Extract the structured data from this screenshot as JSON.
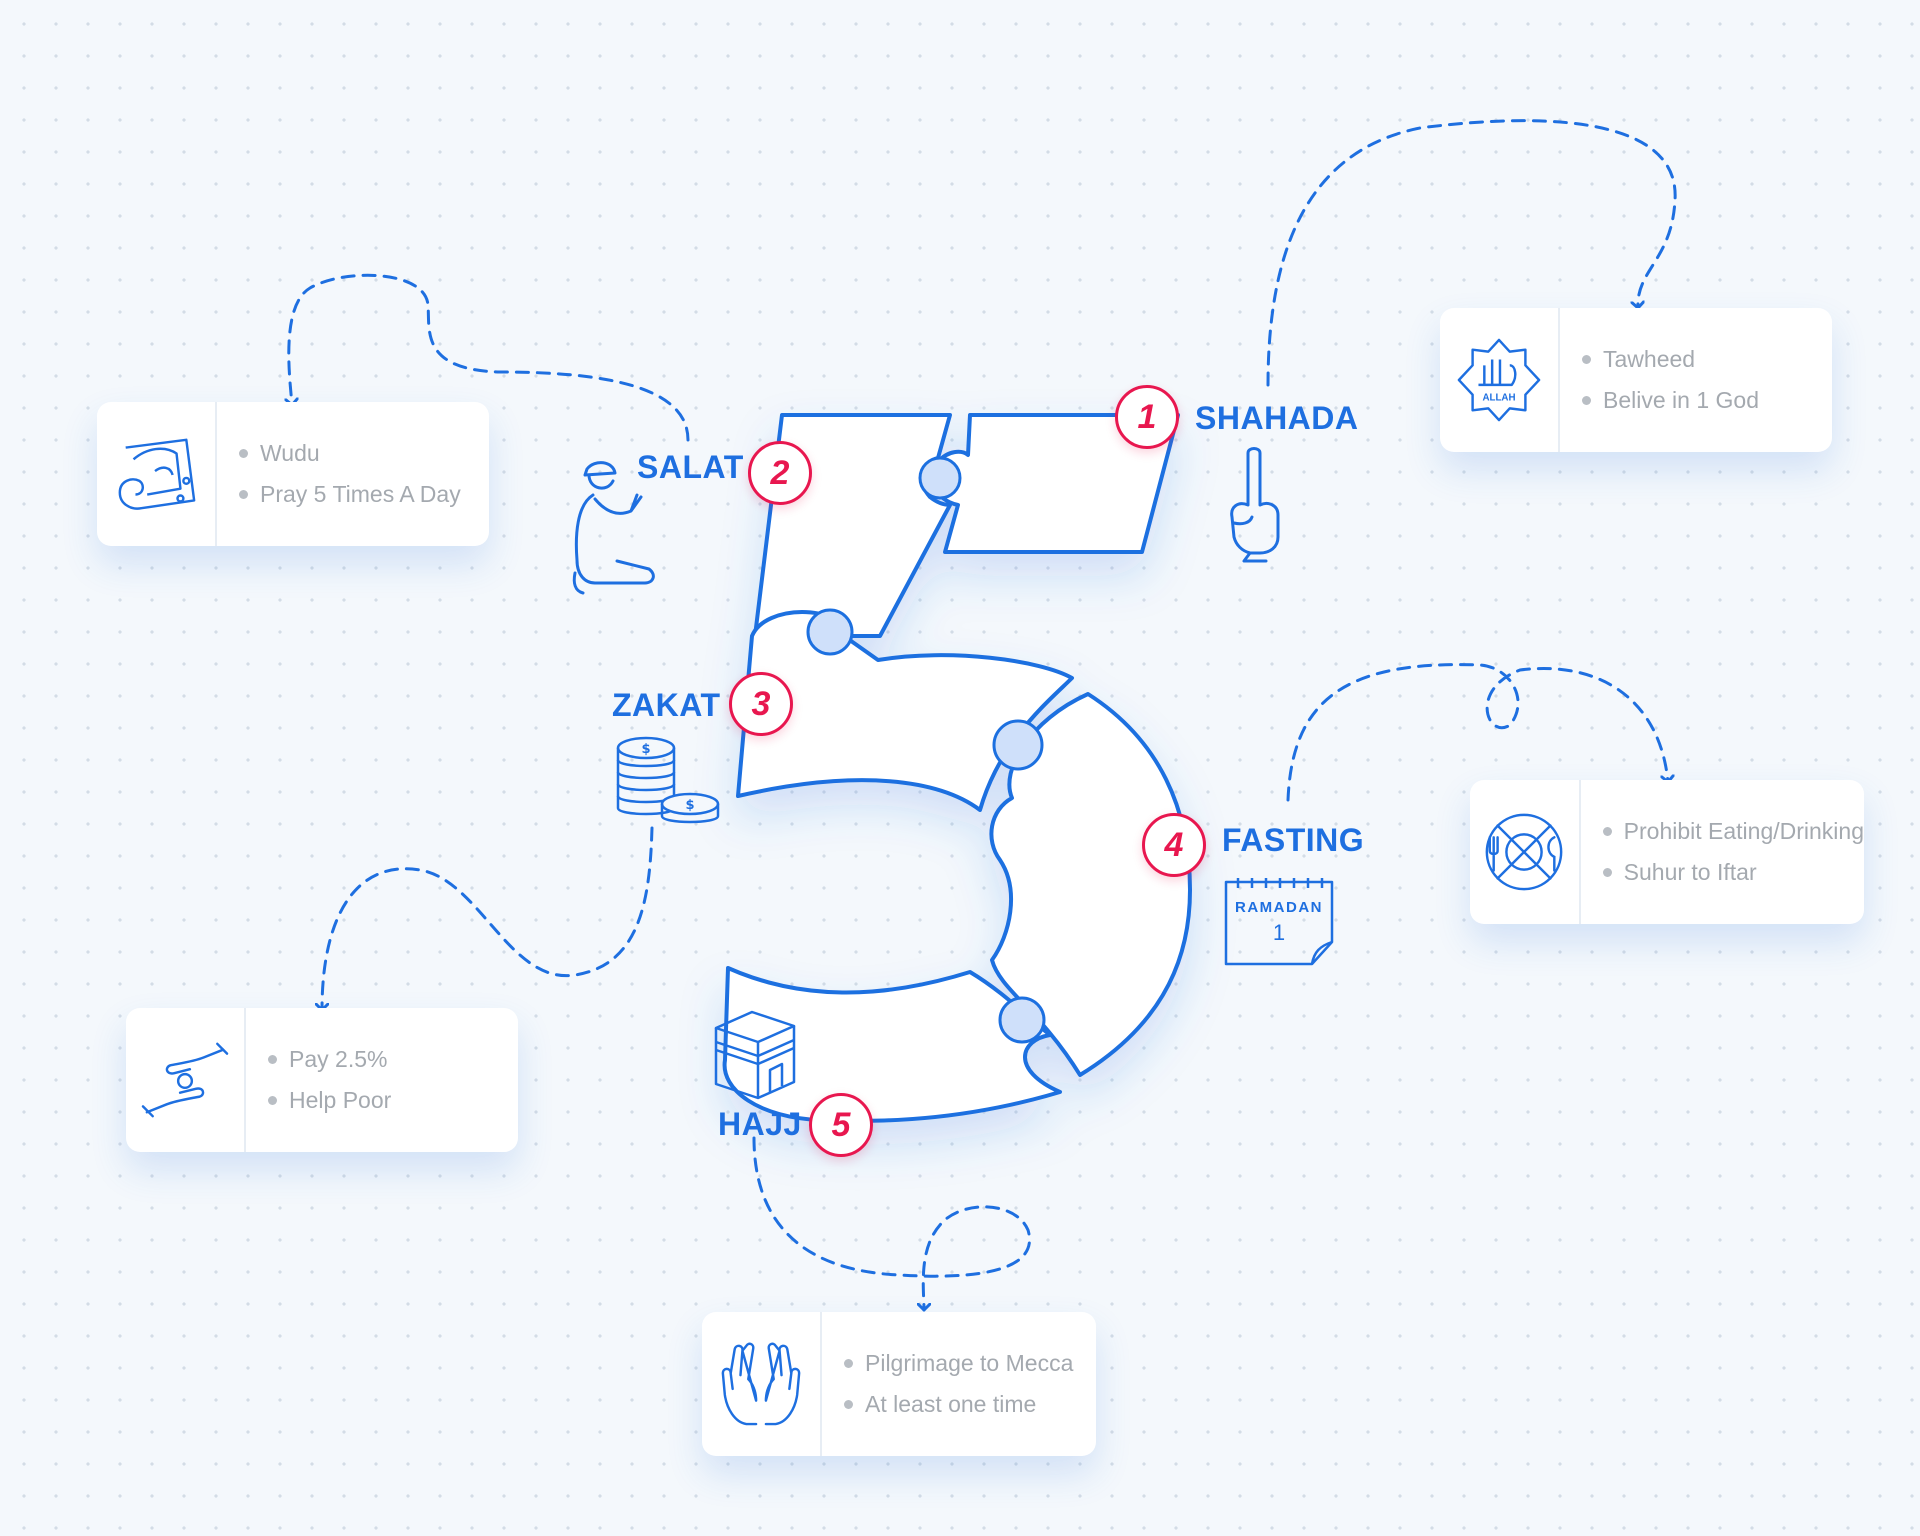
{
  "colors": {
    "accent": "#1e6fe0",
    "number": "#e8174f",
    "bullet_text": "#a4a9af",
    "background": "#f4f8fc"
  },
  "pillars": [
    {
      "number": "1",
      "name": "SHAHADA",
      "icon": "index-finger-up-icon",
      "card_icon": "allah-emblem-icon",
      "card_icon_text": "ALLAH",
      "points": [
        "Tawheed",
        "Belive in 1 God"
      ]
    },
    {
      "number": "2",
      "name": "SALAT",
      "icon": "praying-man-icon",
      "card_icon": "prayer-rug-icon",
      "points": [
        "Wudu",
        "Pray 5 Times A Day"
      ]
    },
    {
      "number": "3",
      "name": "ZAKAT",
      "icon": "coin-stack-icon",
      "card_icon": "giving-hands-icon",
      "points": [
        "Pay 2.5%",
        "Help Poor"
      ]
    },
    {
      "number": "4",
      "name": "FASTING",
      "icon": "ramadan-calendar-icon",
      "icon_text": "RAMADAN",
      "icon_day": "1",
      "card_icon": "no-eating-icon",
      "points": [
        "Prohibit Eating/Drinking",
        "Suhur to Iftar"
      ]
    },
    {
      "number": "5",
      "name": "HAJJ",
      "icon": "kaaba-icon",
      "card_icon": "dua-hands-icon",
      "points": [
        "Pilgrimage to Mecca",
        "At least one time"
      ]
    }
  ]
}
